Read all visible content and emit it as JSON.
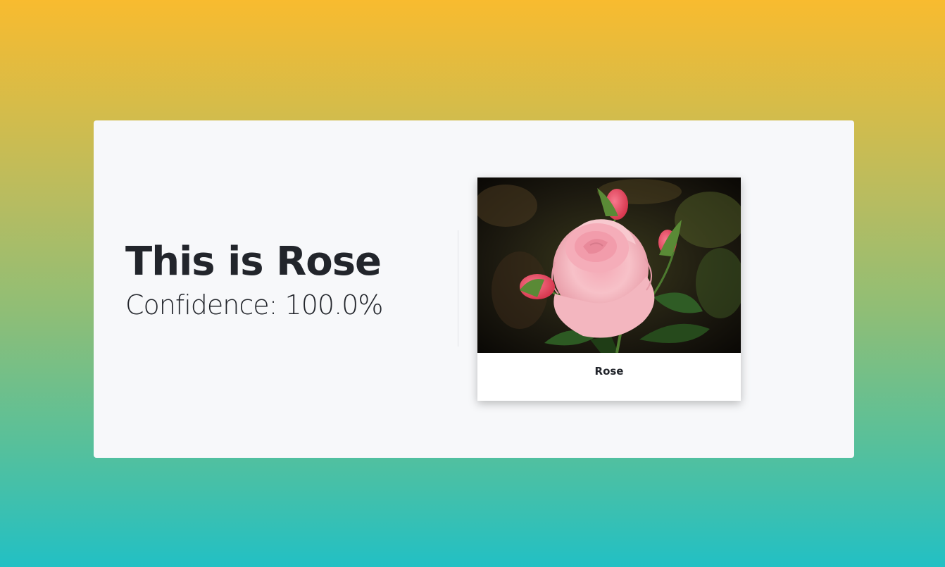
{
  "result": {
    "headline": "This is Rose",
    "confidence": "Confidence: 100.0%"
  },
  "card": {
    "caption": "Rose"
  },
  "colors": {
    "gradient_top": "#f8bb2f",
    "gradient_bottom": "#22c0c4",
    "panel_bg": "#f7f8fa",
    "text": "#22252b"
  }
}
